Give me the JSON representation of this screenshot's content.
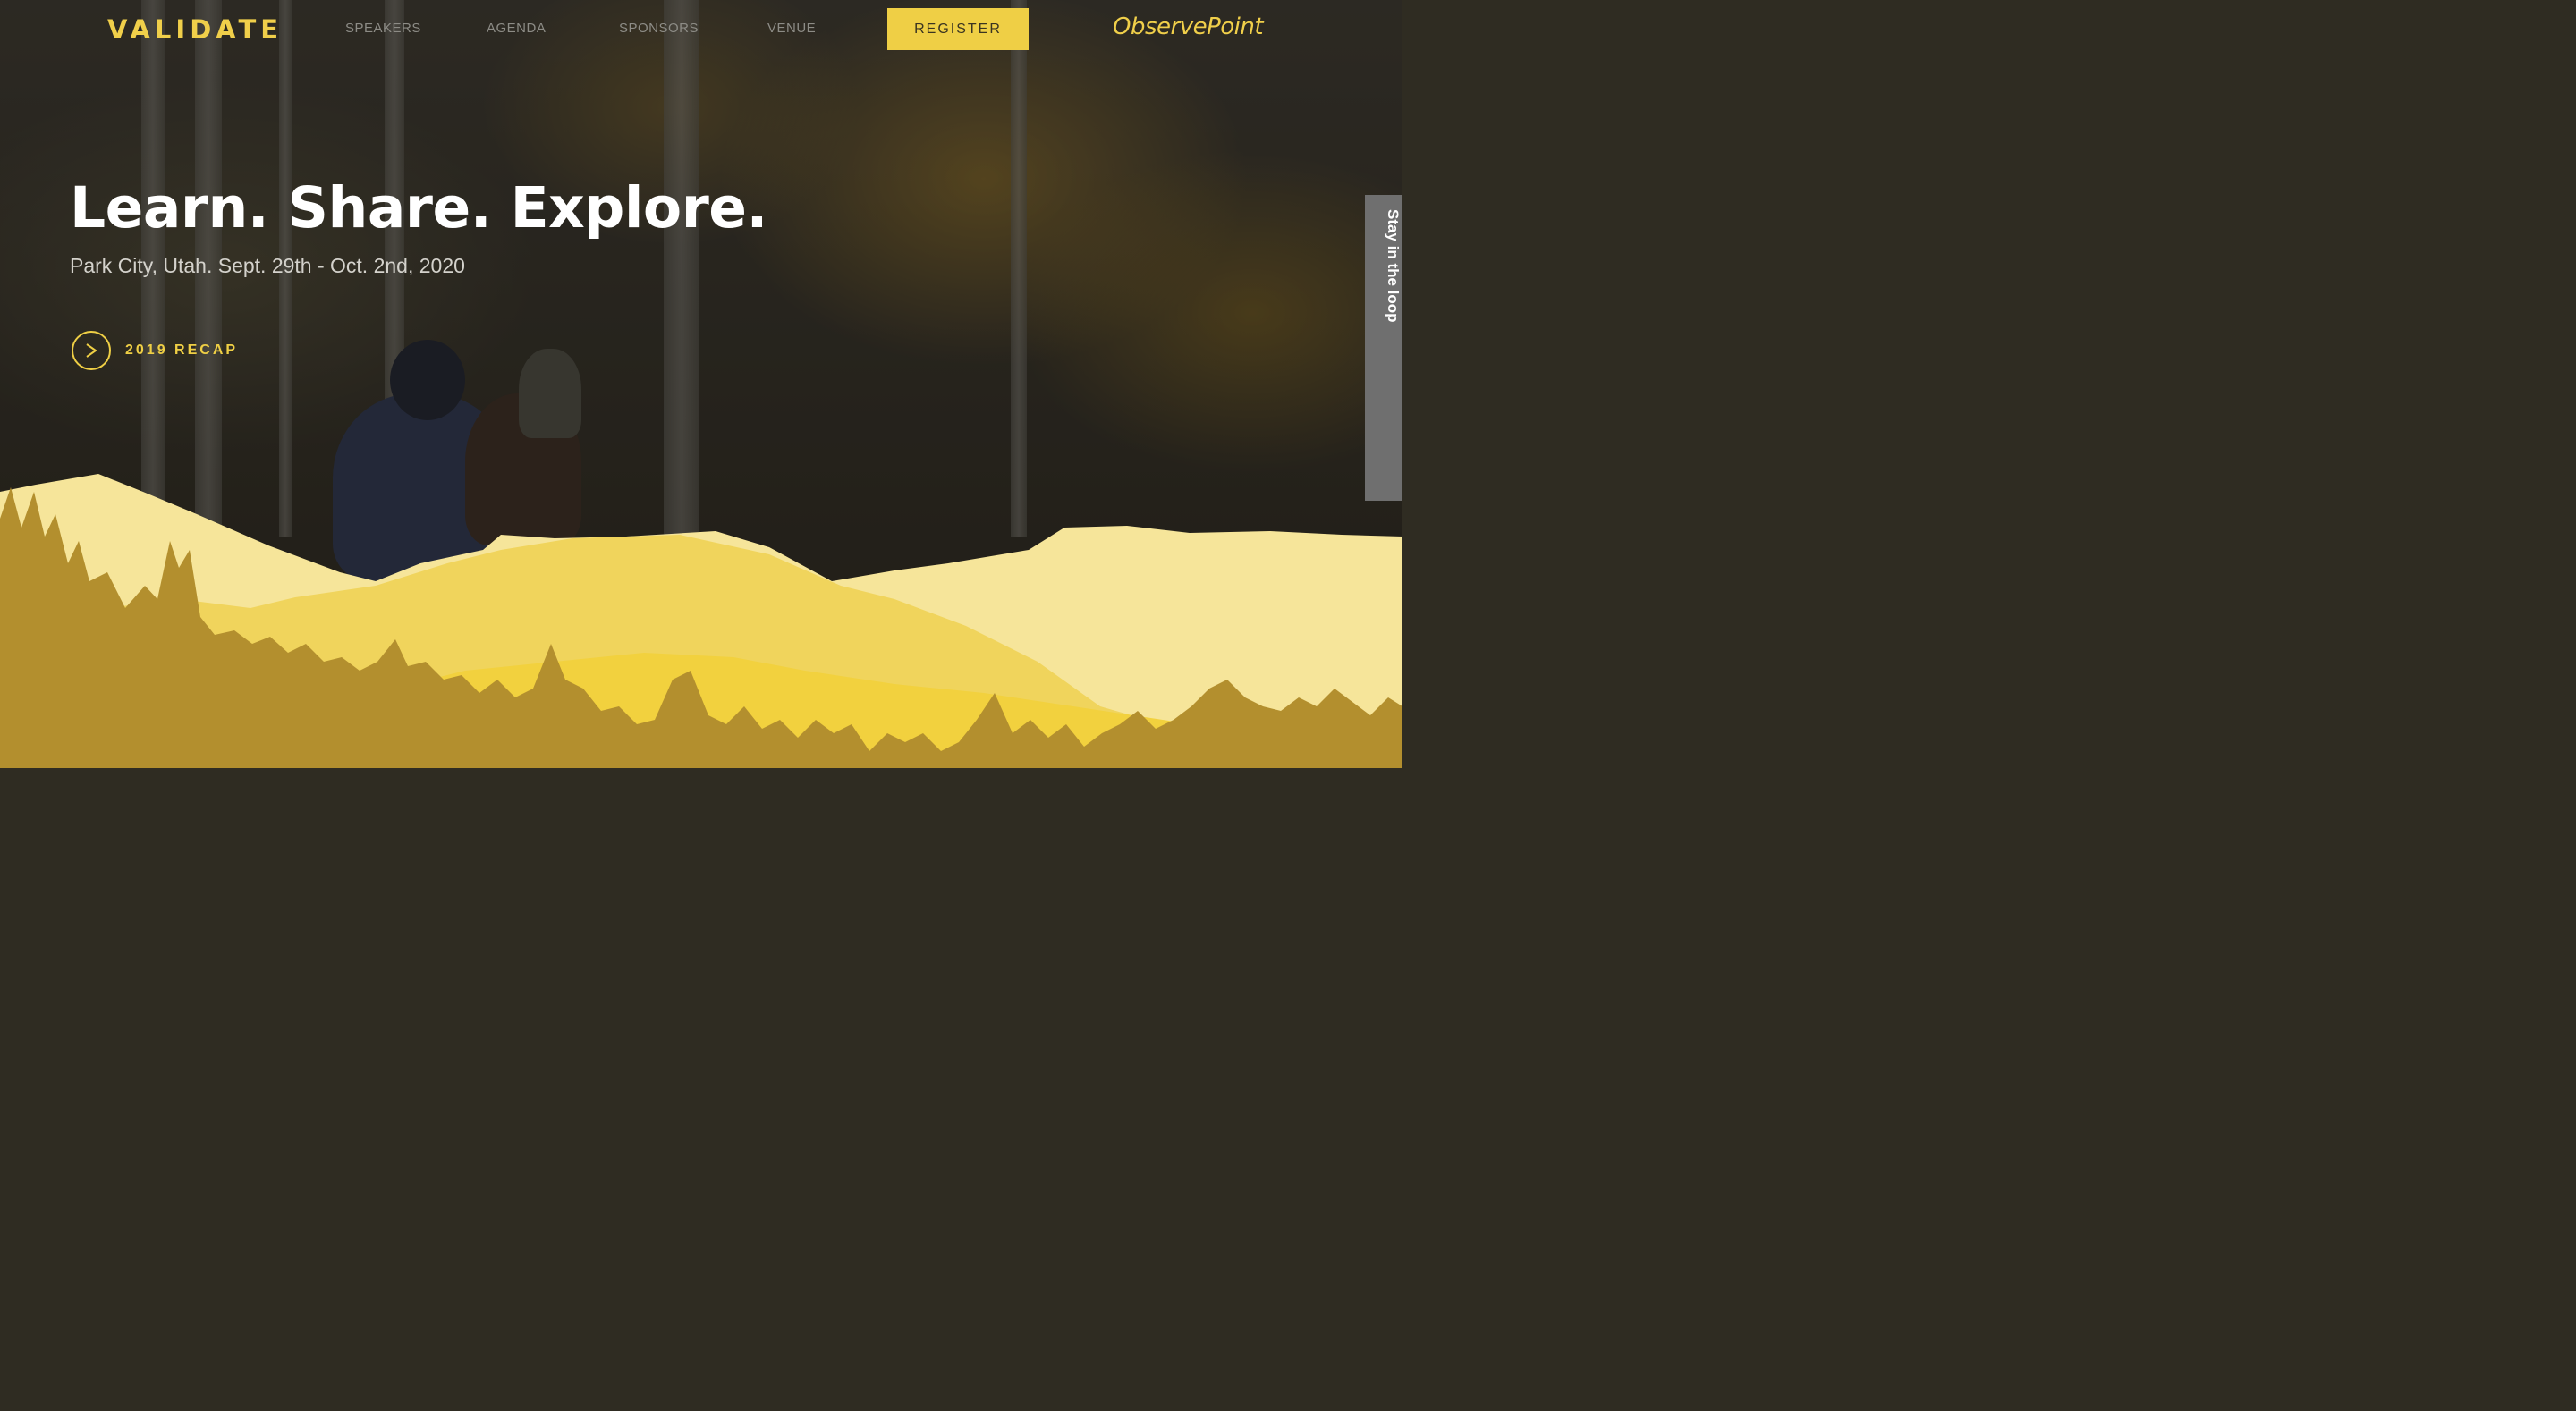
{
  "brand": {
    "logo_text": "VALIDATE",
    "partner_logo_text": "ObservePoint"
  },
  "nav": {
    "links": [
      {
        "label": "SPEAKERS"
      },
      {
        "label": "AGENDA"
      },
      {
        "label": "SPONSORS"
      },
      {
        "label": "VENUE"
      }
    ],
    "register_label": "REGISTER"
  },
  "hero": {
    "headline": "Learn. Share. Explore.",
    "subheadline": "Park City, Utah. Sept. 29th - Oct. 2nd, 2020",
    "recap_label": "2019 RECAP"
  },
  "side_tab": {
    "label": "Stay in the loop"
  },
  "colors": {
    "accent": "#efcf45",
    "hill_light": "#f6e59a",
    "hill_mid": "#f0d45c",
    "tree_dark": "#b38f2e",
    "side_tab_bg": "#6f6f6f"
  },
  "icons": {
    "play": "play-icon"
  }
}
